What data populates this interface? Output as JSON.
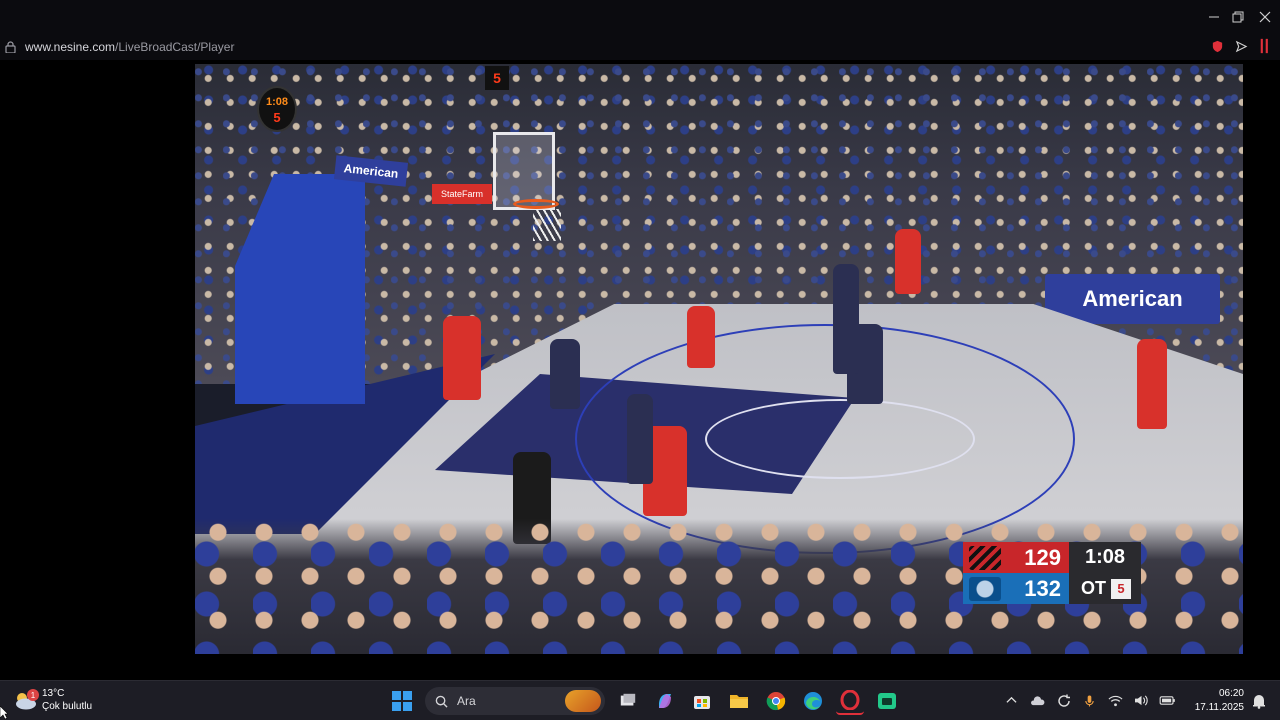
{
  "browser": {
    "url_host": "www.nesine.com",
    "url_path": "/LiveBroadCast/Player"
  },
  "video": {
    "shot_clock": "1:08",
    "shot_clock_sub": "5",
    "shot_clock_2": "5",
    "banner_right": "American",
    "banner_hoop": "American",
    "banner_red": "StateFarm"
  },
  "scorebug": {
    "team1_score": "129",
    "team2_score": "132",
    "game_clock": "1:08",
    "period": "OT",
    "fouls_or_timeouts": "5",
    "team1_color": "#c8262a",
    "team2_color": "#1a6fb8"
  },
  "taskbar": {
    "weather_temp": "13°C",
    "weather_desc": "Çok bulutlu",
    "weather_badge": "1",
    "search_placeholder": "Ara",
    "time": "06:20",
    "date": "17.11.2025",
    "apps": [
      "start-icon",
      "search",
      "file-explorer-icon",
      "copilot-icon",
      "store-icon",
      "folder-icon",
      "chrome-icon",
      "edge-icon",
      "opera-icon",
      "app-icon"
    ]
  }
}
